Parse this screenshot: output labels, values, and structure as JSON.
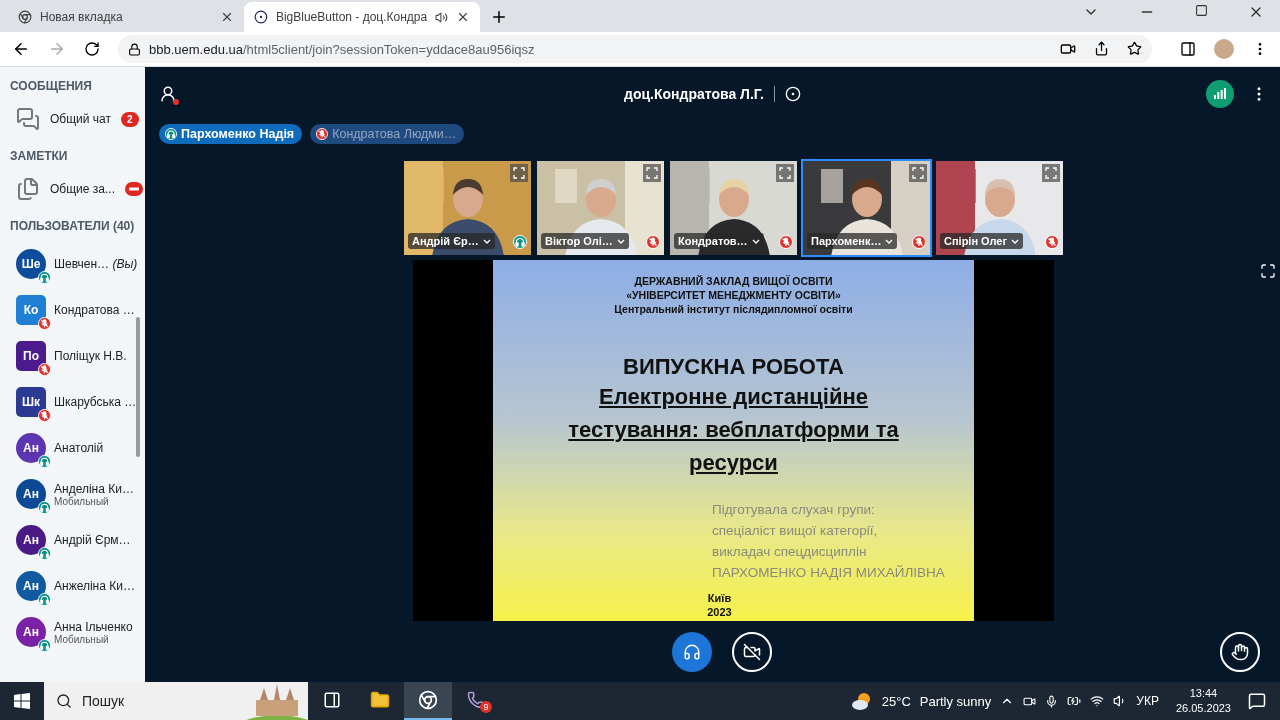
{
  "browser": {
    "tabs": [
      {
        "title": "Новая вкладка",
        "selected": false
      },
      {
        "title": "BigBlueButton - доц.Кондра",
        "selected": true
      }
    ],
    "url_host": "bbb.uem.edu.ua",
    "url_path": "/html5client/join?sessionToken=yddace8au956iqsz"
  },
  "sidebar": {
    "messages_title": "СООБЩЕНИЯ",
    "chat": {
      "label": "Общий чат",
      "badge": "2"
    },
    "notes_title": "ЗАМЕТКИ",
    "notes": {
      "label": "Общие за..."
    },
    "users_title": "ПОЛЬЗОВАТЕЛИ (40)",
    "users": [
      {
        "initials": "Ше",
        "name": "Шевчен…",
        "you": "(Вы)",
        "moderator": false,
        "muted": false,
        "color": "#0e4c9c"
      },
      {
        "initials": "Ко",
        "name": "Кондратова …",
        "moderator": true,
        "muted": true,
        "color": "#1f7fd4"
      },
      {
        "initials": "По",
        "name": "Поліщук Н.В.",
        "moderator": true,
        "muted": true,
        "color": "#4b1a8c"
      },
      {
        "initials": "Шк",
        "name": "Шкарубська …",
        "moderator": true,
        "muted": true,
        "color": "#2c3a94"
      },
      {
        "initials": "Ан",
        "name": "Анатолій",
        "moderator": false,
        "muted": false,
        "color": "#5b36b0"
      },
      {
        "initials": "Ан",
        "name": "Анделіна Ки…",
        "subtitle": "Мобильный",
        "moderator": false,
        "muted": false,
        "color": "#0d4a96"
      },
      {
        "initials": "Ан",
        "name": "Андрій Єрм…",
        "moderator": false,
        "muted": false,
        "color": "#4a1a86"
      },
      {
        "initials": "Ан",
        "name": "Анжеліна Ки…",
        "moderator": false,
        "muted": false,
        "color": "#0f5aa0"
      },
      {
        "initials": "Ан",
        "name": "Анна Ільченко",
        "subtitle": "Мобильный",
        "moderator": false,
        "muted": false,
        "color": "#7a22a6"
      }
    ]
  },
  "header": {
    "title": "доц.Кондратова Л.Г."
  },
  "talkers": [
    {
      "name": "Пархоменко Надія",
      "talking": true
    },
    {
      "name": "Кондратова Людми…",
      "talking": false
    }
  ],
  "videos": [
    {
      "name": "Андрій Єр…",
      "muted": false,
      "selected": false
    },
    {
      "name": "Віктор Олі…",
      "muted": true,
      "selected": false
    },
    {
      "name": "Кондратов…",
      "muted": true,
      "selected": false
    },
    {
      "name": "Пархоменк…",
      "muted": true,
      "selected": true
    },
    {
      "name": "Спірін Олег",
      "muted": true,
      "selected": false
    }
  ],
  "slide": {
    "institution": [
      "ДЕРЖАВНИЙ ЗАКЛАД ВИЩОЇ ОСВІТИ",
      "«УНІВЕРСИТЕТ МЕНЕДЖМЕНТУ ОСВІТИ»",
      "Центральний інститут післядипломної освіти"
    ],
    "title": "ВИПУСКНА РОБОТА",
    "subtitle": "Електронне дистанційне тестування: вебплатформи та ресурси",
    "author": [
      "Підготувала слухач групи:",
      "спеціаліст вищої категорії,",
      "викладач спецдисциплін",
      "ПАРХОМЕНКО НАДІЯ МИХАЙЛІВНА"
    ],
    "city": "Київ",
    "year": "2023"
  },
  "taskbar": {
    "search_placeholder": "Пошук",
    "viber_badge": "9",
    "temperature": "25°C",
    "weather": "Partly sunny",
    "language": "УКР",
    "time": "13:44",
    "date": "26.05.2023"
  }
}
